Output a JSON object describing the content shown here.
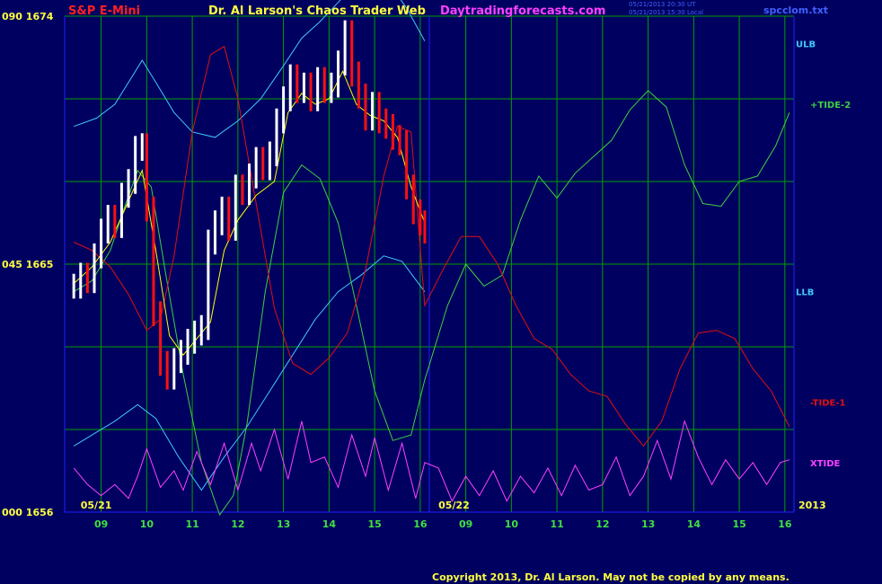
{
  "header": {
    "symbol": "S&P E-Mini",
    "title": "Dr. Al Larson's Chaos Trader Web",
    "site": "Daytradingforecasts.com",
    "timestamp_1": "05/21/2013 20:30 UT",
    "timestamp_2": "05/21/2013 15:30 Local",
    "file": "spcclom.txt"
  },
  "footer": {
    "copyright": "Copyright 2013, Dr. Al Larson. May not be copied by any means."
  },
  "colors": {
    "background": "#000060",
    "grid": "#00a000",
    "axis": "#2020ff",
    "price_up": "#ffffff",
    "price_down": "#ff1010",
    "moving_average": "#ffff00",
    "band": "#40c8ff",
    "tide_plus": "#40d040",
    "tide_minus": "#e01010",
    "xtide": "#ff40ff"
  },
  "chart_data": {
    "type": "line",
    "title": "",
    "y_axis_labels": [
      "090 1674",
      "045 1665",
      "000 1656"
    ],
    "ylim": [
      1656,
      1674
    ],
    "x_hours_day1": [
      "09",
      "10",
      "11",
      "12",
      "13",
      "14",
      "15",
      "16"
    ],
    "x_hours_day2": [
      "09",
      "10",
      "11",
      "12",
      "13",
      "14",
      "15",
      "16"
    ],
    "date_labels": [
      "05/21",
      "05/22"
    ],
    "year_label": "2013",
    "grid": true,
    "series": [
      {
        "name": "ULB",
        "x": [
          8.4,
          8.9,
          9.3,
          9.6,
          9.9,
          10.2,
          10.6,
          11.0,
          11.5,
          12.0,
          12.5,
          13.0,
          13.4,
          13.8,
          14.2,
          14.6,
          15.0,
          15.4,
          15.7,
          16.1
        ],
        "y": [
          1670.0,
          1670.3,
          1670.8,
          1671.6,
          1672.4,
          1671.6,
          1670.5,
          1669.8,
          1669.6,
          1670.2,
          1671.0,
          1672.2,
          1673.2,
          1673.8,
          1674.5,
          1675.2,
          1675.6,
          1675.0,
          1674.3,
          1673.1
        ]
      },
      {
        "name": "LLB",
        "x": [
          8.4,
          8.9,
          9.3,
          9.8,
          10.2,
          10.7,
          11.2,
          11.7,
          12.2,
          12.7,
          13.2,
          13.7,
          14.2,
          14.7,
          15.2,
          15.6,
          16.1
        ],
        "y": [
          1658.4,
          1658.9,
          1659.3,
          1659.9,
          1659.4,
          1658.0,
          1656.8,
          1658.0,
          1659.1,
          1660.4,
          1661.7,
          1663.0,
          1664.0,
          1664.6,
          1665.3,
          1665.1,
          1664.0
        ]
      },
      {
        "name": "+TIDE-2",
        "x": [
          8.4,
          8.8,
          9.2,
          9.5,
          9.8,
          10.1,
          10.4,
          10.8,
          11.2,
          11.6,
          11.9,
          12.2,
          12.6,
          13.0,
          13.4,
          13.8,
          14.2,
          14.6,
          15.0,
          15.4,
          15.8,
          16.1,
          16.6,
          17.0,
          17.4,
          17.8,
          18.2,
          18.6,
          19.0,
          19.4,
          19.8,
          20.2,
          20.6,
          21.0,
          21.4,
          21.8,
          22.2,
          22.6,
          23.0,
          23.4,
          23.8,
          24.1
        ],
        "y": [
          1664.0,
          1664.4,
          1665.5,
          1667.0,
          1668.4,
          1667.8,
          1664.8,
          1661.0,
          1657.8,
          1655.9,
          1656.6,
          1659.2,
          1664.0,
          1667.6,
          1668.6,
          1668.1,
          1666.5,
          1663.5,
          1660.4,
          1658.6,
          1658.8,
          1660.8,
          1663.5,
          1665.0,
          1664.2,
          1664.6,
          1666.6,
          1668.2,
          1667.4,
          1668.3,
          1668.9,
          1669.5,
          1670.6,
          1671.3,
          1670.7,
          1668.6,
          1667.2,
          1667.1,
          1668.0,
          1668.2,
          1669.3,
          1670.5
        ]
      },
      {
        "name": "-TIDE-1",
        "x": [
          8.4,
          8.8,
          9.2,
          9.6,
          10.0,
          10.3,
          10.6,
          11.0,
          11.4,
          11.7,
          12.0,
          12.4,
          12.8,
          13.2,
          13.6,
          14.0,
          14.4,
          14.8,
          15.2,
          15.5,
          15.8,
          16.1,
          16.5,
          16.9,
          17.3,
          17.7,
          18.1,
          18.5,
          18.9,
          19.3,
          19.7,
          20.1,
          20.5,
          20.9,
          21.3,
          21.7,
          22.1,
          22.5,
          22.9,
          23.3,
          23.7,
          24.1
        ],
        "y": [
          1665.8,
          1665.5,
          1664.9,
          1663.9,
          1662.6,
          1663.0,
          1665.3,
          1669.8,
          1672.6,
          1672.9,
          1671.0,
          1667.2,
          1663.4,
          1661.4,
          1661.0,
          1661.6,
          1662.5,
          1664.8,
          1668.2,
          1670.0,
          1669.8,
          1663.5,
          1664.8,
          1666.0,
          1666.0,
          1665.0,
          1663.5,
          1662.3,
          1661.9,
          1661.0,
          1660.4,
          1660.2,
          1659.2,
          1658.4,
          1659.3,
          1661.2,
          1662.5,
          1662.6,
          1662.3,
          1661.2,
          1660.4,
          1659.1
        ]
      },
      {
        "name": "XTIDE",
        "x": [
          8.4,
          8.7,
          9.0,
          9.3,
          9.6,
          9.8,
          10.0,
          10.3,
          10.6,
          10.8,
          11.1,
          11.4,
          11.7,
          12.0,
          12.3,
          12.5,
          12.8,
          13.1,
          13.4,
          13.6,
          13.9,
          14.2,
          14.5,
          14.8,
          15.0,
          15.3,
          15.6,
          15.9,
          16.1,
          16.4,
          16.7,
          17.0,
          17.3,
          17.6,
          17.9,
          18.2,
          18.5,
          18.8,
          19.1,
          19.4,
          19.7,
          20.0,
          20.3,
          20.6,
          20.9,
          21.2,
          21.5,
          21.8,
          22.1,
          22.4,
          22.7,
          23.0,
          23.3,
          23.6,
          23.9,
          24.1
        ],
        "y": [
          1657.6,
          1657.0,
          1656.6,
          1657.0,
          1656.5,
          1657.3,
          1658.3,
          1656.9,
          1657.5,
          1656.8,
          1658.2,
          1657.0,
          1658.5,
          1656.8,
          1658.5,
          1657.5,
          1659.0,
          1657.2,
          1659.3,
          1657.8,
          1658.0,
          1656.9,
          1658.8,
          1657.3,
          1658.7,
          1656.8,
          1658.5,
          1656.5,
          1657.8,
          1657.6,
          1656.4,
          1657.3,
          1656.6,
          1657.5,
          1656.4,
          1657.3,
          1656.7,
          1657.6,
          1656.6,
          1657.7,
          1656.8,
          1657.0,
          1658.0,
          1656.6,
          1657.3,
          1658.6,
          1657.2,
          1659.3,
          1658.0,
          1657.0,
          1657.9,
          1657.2,
          1657.8,
          1657.0,
          1657.8,
          1657.9
        ]
      },
      {
        "name": "MA",
        "x": [
          8.4,
          8.8,
          9.2,
          9.6,
          9.9,
          10.2,
          10.5,
          10.8,
          11.1,
          11.4,
          11.7,
          12.0,
          12.4,
          12.8,
          13.1,
          13.4,
          13.7,
          14.0,
          14.3,
          14.6,
          14.9,
          15.2,
          15.5,
          15.8,
          16.1
        ],
        "y": [
          1664.3,
          1664.9,
          1665.8,
          1667.3,
          1668.4,
          1665.5,
          1662.4,
          1661.7,
          1662.3,
          1662.9,
          1665.5,
          1666.6,
          1667.5,
          1668.0,
          1670.5,
          1671.2,
          1670.8,
          1671.0,
          1672.0,
          1670.8,
          1670.4,
          1670.2,
          1669.6,
          1667.8,
          1666.5
        ]
      },
      {
        "name": "Price",
        "x": [
          8.4,
          8.55,
          8.7,
          8.85,
          9.0,
          9.15,
          9.3,
          9.45,
          9.6,
          9.75,
          9.9,
          10.0,
          10.15,
          10.3,
          10.45,
          10.6,
          10.75,
          10.9,
          11.05,
          11.2,
          11.35,
          11.5,
          11.65,
          11.8,
          11.95,
          12.1,
          12.25,
          12.4,
          12.55,
          12.7,
          12.85,
          13.0,
          13.15,
          13.3,
          13.45,
          13.6,
          13.75,
          13.9,
          14.05,
          14.2,
          14.35,
          14.5,
          14.65,
          14.8,
          14.95,
          15.1,
          15.25,
          15.4,
          15.55,
          15.7,
          15.85,
          16.0,
          16.1
        ],
        "y": [
          1664.2,
          1664.6,
          1664.4,
          1665.3,
          1666.2,
          1666.7,
          1666.4,
          1667.5,
          1668.0,
          1669.2,
          1669.3,
          1667.0,
          1663.2,
          1661.4,
          1660.9,
          1661.5,
          1661.8,
          1662.2,
          1662.5,
          1662.7,
          1665.8,
          1666.5,
          1667.0,
          1666.3,
          1667.8,
          1667.6,
          1668.2,
          1668.8,
          1668.5,
          1669.0,
          1670.2,
          1671.0,
          1671.8,
          1671.3,
          1671.5,
          1671.0,
          1671.7,
          1671.3,
          1671.5,
          1672.3,
          1673.4,
          1671.9,
          1671.1,
          1670.3,
          1670.8,
          1670.2,
          1670.0,
          1669.6,
          1669.4,
          1667.8,
          1666.9,
          1666.5,
          1666.2
        ]
      }
    ],
    "series_labels": [
      "ULB",
      "+TIDE-2",
      "LLB",
      "-TIDE-1",
      "XTIDE"
    ]
  }
}
